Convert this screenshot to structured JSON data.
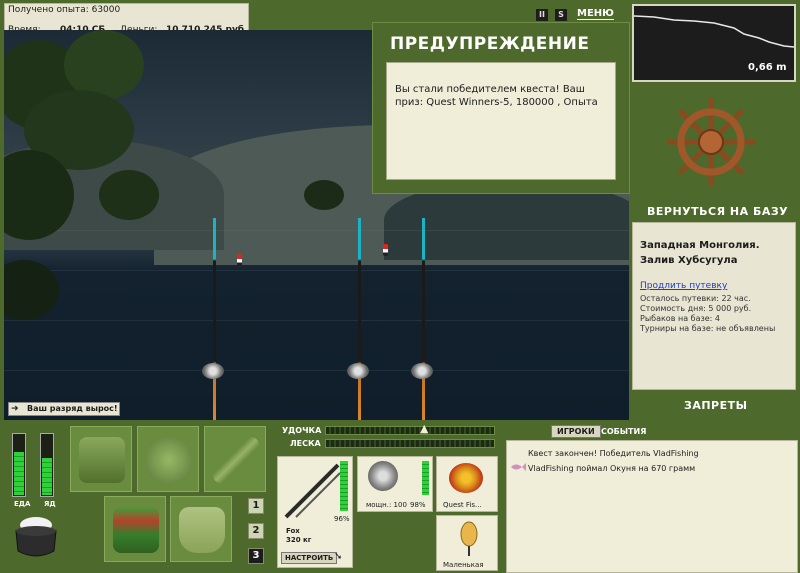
{
  "hud": {
    "experience_label": "Получено опыта: 63000",
    "time_label": "Время:",
    "time_value": "04:10 СБ",
    "money_label": "Деньги:",
    "money_value": "10 710 245 руб."
  },
  "toast": {
    "rank_up": "Ваш разряд вырос!"
  },
  "warning": {
    "title": "ПРЕДУПРЕЖДЕНИЕ",
    "message": "Вы стали победителем квеста! Ваш приз: Quest Winners-5, 180000 , Опыта"
  },
  "top_icons": {
    "pause": "II",
    "sound": "S",
    "menu": "МЕНЮ"
  },
  "depth_chart": {
    "value": "0,66 m"
  },
  "base": {
    "return_label": "ВЕРНУТЬСЯ НА БАЗУ",
    "bans_label": "ЗАПРЕТЫ"
  },
  "location": {
    "title": "Западная Монголия. Залив Хубсугула",
    "extend_link": "Продлить путевку",
    "lines": [
      "Осталось путевки: 22 час.",
      "Стоимость дня: 5 000 руб.",
      "Рыбаков на базе: 4",
      "Турниры на базе: не объявлены"
    ]
  },
  "meters": {
    "food_label": "ЕДА",
    "poison_label": "ЯД",
    "food_level": 0.7,
    "poison_level": 0.6
  },
  "inventory_numbers": [
    "1",
    "2",
    "3"
  ],
  "rod_settings": {
    "rod_label": "УДОЧКА",
    "line_label": "ЛЕСКА",
    "rod_name": "Fox",
    "rod_weight": "320 кг",
    "rod_condition": "96%",
    "reel_power": "мощн.: 100",
    "reel_condition": "98%",
    "line_name": "Quest Fis...",
    "lure_name": "Маленькая",
    "tune_button": "НАСТРОИТЬ"
  },
  "chat": {
    "tabs": [
      "ИГРОКИ",
      "СОБЫТИЯ"
    ],
    "messages": [
      "Квест закончен! Победитель VladFishing",
      "VladFishing поймал Окуня на 670 грамм"
    ]
  },
  "colors": {
    "panel_green": "#4d6a2c",
    "paper": "#f0eed9",
    "accent_cyan": "#1db3c6"
  }
}
